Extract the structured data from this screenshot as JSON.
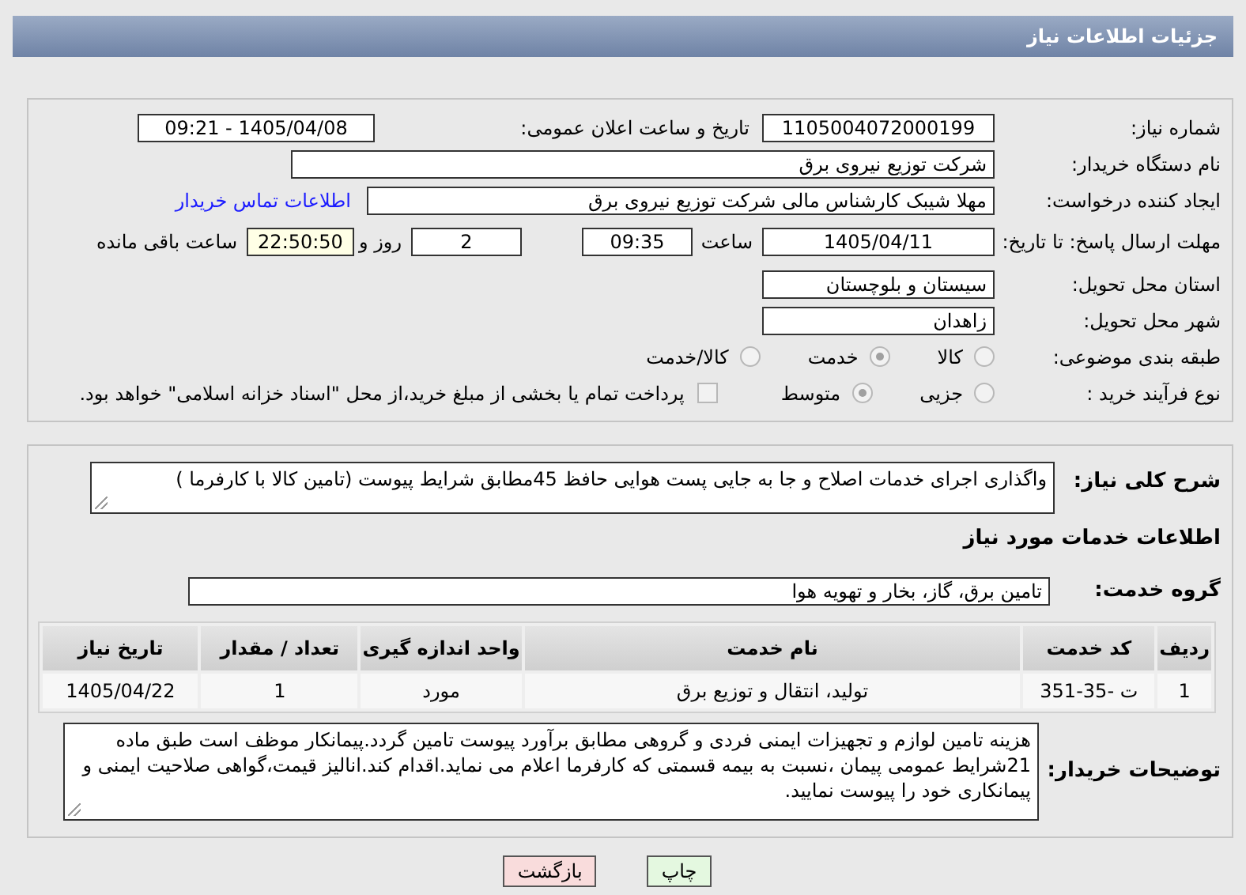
{
  "header": {
    "title": "جزئیات اطلاعات نیاز"
  },
  "details": {
    "need_number": {
      "label": "شماره نیاز:",
      "value": "1105004072000199"
    },
    "announce": {
      "label": "تاریخ و ساعت اعلان عمومی:",
      "value": "1405/04/08 - 09:21"
    },
    "buyer": {
      "label": "نام دستگاه خریدار:",
      "value": "شرکت توزیع نیروی برق"
    },
    "creator": {
      "label": "ایجاد کننده درخواست:",
      "value": "مهلا شیبک کارشناس مالی شرکت توزیع نیروی برق",
      "link": "اطلاعات تماس خریدار"
    },
    "deadline": {
      "label": "مهلت ارسال پاسخ: تا تاریخ:",
      "date": "1405/04/11",
      "time_label": "ساعت",
      "time": "09:35",
      "days": "2",
      "days_label": "روز و",
      "remaining": "22:50:50",
      "remaining_label": "ساعت باقی مانده"
    },
    "province": {
      "label": "استان محل تحویل:",
      "value": "سیستان و بلوچستان"
    },
    "city": {
      "label": "شهر محل تحویل:",
      "value": "زاهدان"
    },
    "category": {
      "label": "طبقه بندی موضوعی:",
      "options": [
        {
          "label": "کالا",
          "selected": false
        },
        {
          "label": "خدمت",
          "selected": true
        },
        {
          "label": "کالا/خدمت",
          "selected": false
        }
      ]
    },
    "process": {
      "label": "نوع فرآیند خرید :",
      "options": [
        {
          "label": "جزیی",
          "selected": false
        },
        {
          "label": "متوسط",
          "selected": true
        }
      ],
      "payment": {
        "checked": false,
        "text": "پرداخت تمام یا بخشی از مبلغ خرید،از محل \"اسناد خزانه اسلامی\" خواهد بود."
      }
    }
  },
  "services": {
    "summary": {
      "label": "شرح کلی نیاز:",
      "value": "واگذاری اجرای خدمات اصلاح و جا به جایی پست هوایی حافظ 45مطابق شرایط پیوست (تامین کالا با کارفرما )"
    },
    "heading": "اطلاعات خدمات مورد نیاز",
    "group": {
      "label": "گروه خدمت:",
      "value": "تامین برق، گاز، بخار و تهویه هوا"
    },
    "table": {
      "columns": [
        "ردیف",
        "کد خدمت",
        "نام خدمت",
        "واحد اندازه گیری",
        "تعداد / مقدار",
        "تاریخ نیاز"
      ],
      "rows": [
        [
          "1",
          "ت -35-351",
          "تولید، انتقال و توزیع برق",
          "مورد",
          "1",
          "1405/04/22"
        ]
      ]
    },
    "notes": {
      "label": "توضیحات خریدار:",
      "value": "هزینه تامین لوازم و تجهیزات ایمنی فردی و گروهی مطابق برآورد پیوست تامین گردد.پیمانکار موظف است طبق ماده 21شرایط عمومی پیمان ،نسبت به بیمه قسمتی که کارفرما اعلام می نماید.اقدام کند.انالیز قیمت،گواهی صلاحیت ایمنی و پیمانکاری خود را پیوست نمایید."
    }
  },
  "buttons": [
    {
      "label": "چاپ",
      "kind": "print"
    },
    {
      "label": "بازگشت",
      "kind": "back"
    }
  ]
}
